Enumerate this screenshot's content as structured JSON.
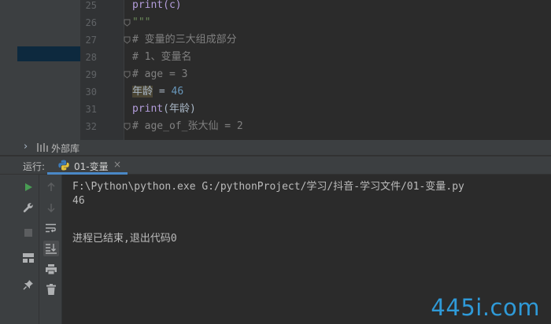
{
  "editor": {
    "lines": [
      {
        "num": "25",
        "tokens": [
          {
            "t": "print",
            "c": "kw"
          },
          {
            "t": "(c)",
            "c": "kw"
          }
        ]
      },
      {
        "num": "26",
        "tokens": [
          {
            "t": "\"\"\"",
            "c": "str"
          }
        ],
        "fold": true
      },
      {
        "num": "27",
        "tokens": [
          {
            "t": "# 变量的三大组成部分",
            "c": "cmt"
          }
        ],
        "fold": true
      },
      {
        "num": "28",
        "tokens": [
          {
            "t": "# 1、变量名",
            "c": "cmt"
          }
        ]
      },
      {
        "num": "29",
        "tokens": [
          {
            "t": "# age = 3",
            "c": "cmt"
          }
        ],
        "fold": true
      },
      {
        "num": "30",
        "tokens": [
          {
            "t": "年龄",
            "c": "plain hlvar"
          },
          {
            "t": " = ",
            "c": "plain"
          },
          {
            "t": "46",
            "c": "num"
          }
        ]
      },
      {
        "num": "31",
        "tokens": [
          {
            "t": "print",
            "c": "kw"
          },
          {
            "t": "(年龄)",
            "c": "plain"
          }
        ]
      },
      {
        "num": "32",
        "tokens": [
          {
            "t": "# age_of_张大仙 = 2",
            "c": "cmt"
          }
        ],
        "fold": true
      }
    ]
  },
  "project": {
    "external_libs_label": "外部库"
  },
  "run": {
    "label": "运行:",
    "tab_name": "01-变量",
    "tab_close": "×",
    "console_lines": [
      "F:\\Python\\python.exe G:/pythonProject/学习/抖音-学习文件/01-变量.py",
      "46",
      "",
      "进程已结束,退出代码0"
    ]
  },
  "colors": {
    "accent": "#4a88c7",
    "run_green": "#499c54",
    "watermark": "#2f9ad8"
  },
  "watermark": "445i.com"
}
